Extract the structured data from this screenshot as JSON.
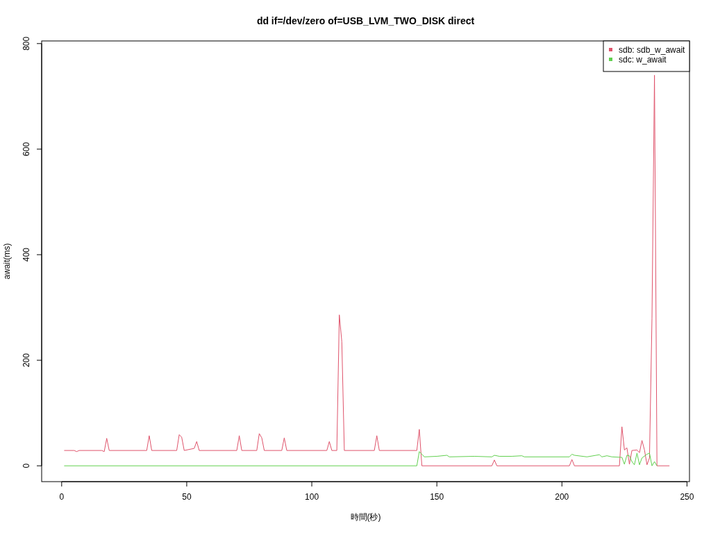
{
  "chart_data": {
    "type": "line",
    "title": "dd if=/dev/zero of=USB_LVM_TWO_DISK direct",
    "xlabel": "時間(秒)",
    "ylabel": "await(ms)",
    "xlim": [
      -8,
      251
    ],
    "ylim": [
      -30,
      805
    ],
    "xticks": [
      0,
      50,
      100,
      150,
      200,
      250
    ],
    "yticks": [
      0,
      200,
      400,
      600,
      800
    ],
    "legend": true,
    "series": [
      {
        "name": "sdb: sdb_w_await",
        "color": "#df536b",
        "x": [
          1,
          5,
          6,
          7,
          16,
          17,
          18,
          19,
          34,
          35,
          36,
          46,
          47,
          48,
          49,
          53,
          54,
          55,
          70,
          71,
          72,
          78,
          79,
          80,
          81,
          88,
          89,
          90,
          106,
          107,
          108,
          110,
          111,
          112,
          113,
          125,
          126,
          127,
          142,
          143,
          144,
          172,
          173,
          174,
          203,
          204,
          205,
          223,
          224,
          225,
          226,
          227,
          228,
          230,
          231,
          232,
          233,
          234,
          235,
          236,
          237,
          238,
          243
        ],
        "values": [
          29,
          29,
          27,
          29,
          29,
          27,
          52,
          29,
          29,
          57,
          29,
          29,
          59,
          54,
          29,
          33,
          46,
          29,
          29,
          57,
          29,
          29,
          61,
          53,
          29,
          29,
          53,
          29,
          29,
          46,
          29,
          29,
          286,
          235,
          29,
          29,
          57,
          29,
          29,
          69,
          0,
          0,
          11,
          0,
          0,
          12,
          0,
          0,
          74,
          30,
          34,
          3,
          29,
          30,
          25,
          48,
          30,
          2,
          15,
          280,
          740,
          0,
          0
        ]
      },
      {
        "name": "sdc: w_await",
        "color": "#61d04f",
        "x": [
          1,
          142,
          143,
          144,
          145,
          150,
          154,
          155,
          165,
          172,
          173,
          175,
          180,
          184,
          185,
          203,
          204,
          205,
          210,
          215,
          216,
          218,
          220,
          224,
          225,
          226,
          227,
          228,
          229,
          230,
          231,
          232,
          234,
          235,
          236,
          237,
          238
        ],
        "values": [
          0,
          0,
          27,
          22,
          17,
          18,
          20,
          17,
          18,
          17,
          20,
          18,
          18,
          19,
          17,
          17,
          22,
          20,
          17,
          21,
          17,
          19,
          17,
          16,
          3,
          20,
          19,
          8,
          2,
          24,
          2,
          15,
          22,
          24,
          0,
          8,
          0
        ]
      }
    ]
  }
}
